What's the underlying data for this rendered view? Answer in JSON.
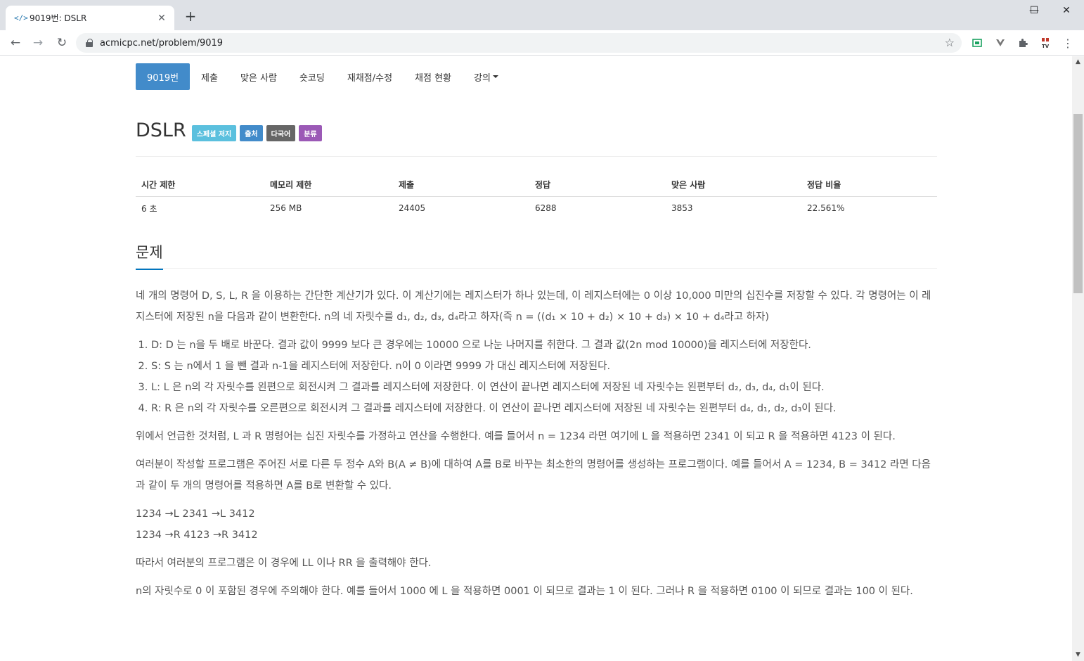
{
  "browser": {
    "tab_title": "9019번: DSLR",
    "tab_favicon": "</>",
    "url": "acmicpc.net/problem/9019",
    "new_tab": "+",
    "window_controls": [
      "—",
      "☐",
      "✕"
    ]
  },
  "subnav": {
    "items": [
      {
        "label": "9019번",
        "active": true
      },
      {
        "label": "제출"
      },
      {
        "label": "맞은 사람"
      },
      {
        "label": "숏코딩"
      },
      {
        "label": "재채점/수정"
      },
      {
        "label": "채점 현황"
      },
      {
        "label": "강의"
      }
    ]
  },
  "problem": {
    "title": "DSLR",
    "labels": [
      "스페셜 저지",
      "출처",
      "다국어",
      "분류"
    ]
  },
  "stats": {
    "headers": [
      "시간 제한",
      "메모리 제한",
      "제출",
      "정답",
      "맞은 사람",
      "정답 비율"
    ],
    "values": [
      "6 초",
      "256 MB",
      "24405",
      "6288",
      "3853",
      "22.561%"
    ]
  },
  "section": {
    "title": "문제"
  },
  "text": {
    "p1": "네 개의 명령어 D, S, L, R 을 이용하는 간단한 계산기가 있다. 이 계산기에는 레지스터가 하나 있는데, 이 레지스터에는 0 이상 10,000 미만의 십진수를 저장할 수 있다. 각 명령어는 이 레지스터에 저장된 n을 다음과 같이 변환한다. n의 네 자릿수를 d₁, d₂, d₃, d₄라고 하자(즉 n = ((d₁ × 10 + d₂) × 10 + d₃) × 10 + d₄라고 하자)",
    "list": [
      "D: D 는 n을 두 배로 바꾼다. 결과 값이 9999 보다 큰 경우에는 10000 으로 나눈 나머지를 취한다. 그 결과 값(2n mod 10000)을 레지스터에 저장한다.",
      "S: S 는 n에서 1 을 뺀 결과 n-1을 레지스터에 저장한다. n이 0 이라면 9999 가 대신 레지스터에 저장된다.",
      "L: L 은 n의 각 자릿수를 왼편으로 회전시켜 그 결과를 레지스터에 저장한다. 이 연산이 끝나면 레지스터에 저장된 네 자릿수는 왼편부터 d₂, d₃, d₄, d₁이 된다.",
      "R: R 은 n의 각 자릿수를 오른편으로 회전시켜 그 결과를 레지스터에 저장한다. 이 연산이 끝나면 레지스터에 저장된 네 자릿수는 왼편부터 d₄, d₁, d₂, d₃이 된다."
    ],
    "p2": "위에서 언급한 것처럼, L 과 R 명령어는 십진 자릿수를 가정하고 연산을 수행한다. 예를 들어서 n = 1234 라면 여기에 L 을 적용하면 2341 이 되고 R 을 적용하면 4123 이 된다.",
    "p3": "여러분이 작성할 프로그램은 주어진 서로 다른 두 정수 A와 B(A ≠ B)에 대하여 A를 B로 바꾸는 최소한의 명령어를 생성하는 프로그램이다. 예를 들어서 A = 1234, B = 3412 라면 다음과 같이 두 개의 명령어를 적용하면 A를 B로 변환할 수 있다.",
    "ex1": "1234 →L 2341 →L 3412",
    "ex2": "1234 →R 4123 →R 3412",
    "p4": "따라서 여러분의 프로그램은 이 경우에 LL 이나 RR 을 출력해야 한다.",
    "p5": "n의 자릿수로 0 이 포함된 경우에 주의해야 한다. 예를 들어서 1000 에 L 을 적용하면 0001 이 되므로 결과는 1 이 된다. 그러나 R 을 적용하면 0100 이 되므로 결과는 100 이 된다."
  }
}
